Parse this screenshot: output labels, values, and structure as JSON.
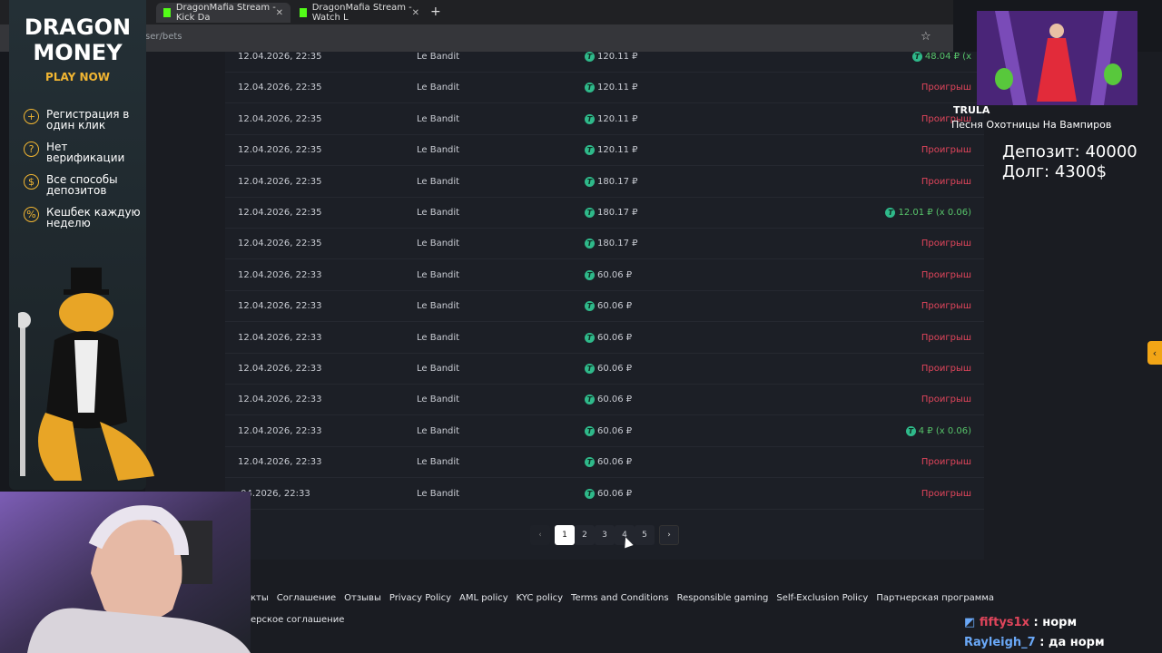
{
  "browser": {
    "tabs": [
      "DragonMafia Stream - Kick Da",
      "DragonMafia Stream - Watch L"
    ],
    "new_tab": "+",
    "url": "ser/bets"
  },
  "ad": {
    "title1": "DRAGON",
    "title2": "MONEY",
    "play": "PLAY NOW",
    "features": [
      "Регистрация в один клик",
      "Нет верификации",
      "Все способы депозитов",
      "Кешбек каждую неделю"
    ]
  },
  "bets": [
    {
      "date": "12.04.2026, 22:35",
      "game": "Le Bandit",
      "bet": "120.11 ₽",
      "result": "48.04 ₽ (x",
      "win": true
    },
    {
      "date": "12.04.2026, 22:35",
      "game": "Le Bandit",
      "bet": "120.11 ₽",
      "result": "Проигрыш",
      "win": false
    },
    {
      "date": "12.04.2026, 22:35",
      "game": "Le Bandit",
      "bet": "120.11 ₽",
      "result": "Проигрыш",
      "win": false
    },
    {
      "date": "12.04.2026, 22:35",
      "game": "Le Bandit",
      "bet": "120.11 ₽",
      "result": "Проигрыш",
      "win": false
    },
    {
      "date": "12.04.2026, 22:35",
      "game": "Le Bandit",
      "bet": "180.17 ₽",
      "result": "Проигрыш",
      "win": false
    },
    {
      "date": "12.04.2026, 22:35",
      "game": "Le Bandit",
      "bet": "180.17 ₽",
      "result": "12.01 ₽ (x 0.06)",
      "win": true
    },
    {
      "date": "12.04.2026, 22:35",
      "game": "Le Bandit",
      "bet": "180.17 ₽",
      "result": "Проигрыш",
      "win": false
    },
    {
      "date": "12.04.2026, 22:33",
      "game": "Le Bandit",
      "bet": "60.06 ₽",
      "result": "Проигрыш",
      "win": false
    },
    {
      "date": "12.04.2026, 22:33",
      "game": "Le Bandit",
      "bet": "60.06 ₽",
      "result": "Проигрыш",
      "win": false
    },
    {
      "date": "12.04.2026, 22:33",
      "game": "Le Bandit",
      "bet": "60.06 ₽",
      "result": "Проигрыш",
      "win": false
    },
    {
      "date": "12.04.2026, 22:33",
      "game": "Le Bandit",
      "bet": "60.06 ₽",
      "result": "Проигрыш",
      "win": false
    },
    {
      "date": "12.04.2026, 22:33",
      "game": "Le Bandit",
      "bet": "60.06 ₽",
      "result": "Проигрыш",
      "win": false
    },
    {
      "date": "12.04.2026, 22:33",
      "game": "Le Bandit",
      "bet": "60.06 ₽",
      "result": "4 ₽ (x 0.06)",
      "win": true
    },
    {
      "date": "12.04.2026, 22:33",
      "game": "Le Bandit",
      "bet": "60.06 ₽",
      "result": "Проигрыш",
      "win": false
    },
    {
      "date": ".04.2026, 22:33",
      "game": "Le Bandit",
      "bet": "60.06 ₽",
      "result": "Проигрыш",
      "win": false
    }
  ],
  "coin_symbol": "T",
  "pagination": {
    "pages": [
      "1",
      "2",
      "3",
      "4",
      "5"
    ],
    "current": "1",
    "prev": "‹",
    "next": "›"
  },
  "footer": {
    "links": [
      "кты",
      "Соглашение",
      "Отзывы",
      "Privacy Policy",
      "AML policy",
      "KYC policy",
      "Terms and Conditions",
      "Responsible gaming",
      "Self-Exclusion Policy",
      "Партнерская программа"
    ],
    "line2": "ерское соглашение"
  },
  "overlay": {
    "artist": "TRULA",
    "song": "Песня Охотницы На Вампиров",
    "deposit": "Депозит: 40000",
    "debt": "Долг: 4300$",
    "side_arrow": "‹"
  },
  "chat": [
    {
      "user": "fiftys1x",
      "sep": " : ",
      "msg": "норм"
    },
    {
      "user": "Rayleigh_7",
      "sep": " : ",
      "msg": "да норм"
    }
  ],
  "colors": {
    "win": "#57c46a",
    "lose": "#e0455b",
    "accent": "#f2b632",
    "coin": "#2fb98a"
  }
}
